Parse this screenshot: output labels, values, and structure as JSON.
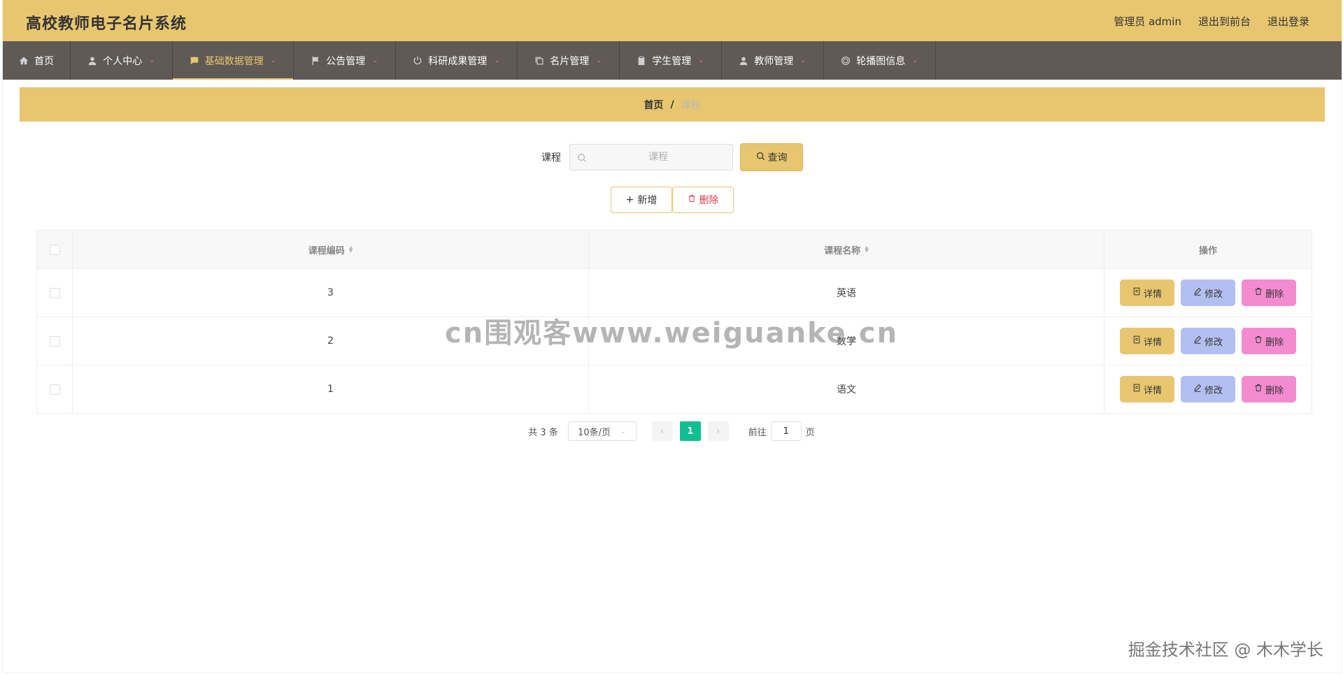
{
  "app": {
    "title": "高校教师电子名片系统"
  },
  "header_actions": {
    "admin": "管理员 admin",
    "front": "退出到前台",
    "logout": "退出登录"
  },
  "nav": [
    {
      "label": "首页",
      "icon": "home-icon",
      "dropdown": false,
      "active": false
    },
    {
      "label": "个人中心",
      "icon": "user-icon",
      "dropdown": true,
      "active": false
    },
    {
      "label": "基础数据管理",
      "icon": "message-icon",
      "dropdown": true,
      "active": true
    },
    {
      "label": "公告管理",
      "icon": "flag-icon",
      "dropdown": true,
      "active": false
    },
    {
      "label": "科研成果管理",
      "icon": "power-icon",
      "dropdown": true,
      "active": false
    },
    {
      "label": "名片管理",
      "icon": "copy-icon",
      "dropdown": true,
      "active": false
    },
    {
      "label": "学生管理",
      "icon": "clipboard-icon",
      "dropdown": true,
      "active": false
    },
    {
      "label": "教师管理",
      "icon": "user-icon",
      "dropdown": true,
      "active": false
    },
    {
      "label": "轮播图信息",
      "icon": "target-icon",
      "dropdown": true,
      "active": false
    }
  ],
  "breadcrumb": {
    "home": "首页",
    "separator": "/",
    "current": "课程"
  },
  "search": {
    "label": "课程",
    "placeholder": "课程",
    "value": "",
    "button": "查询"
  },
  "actions": {
    "add": "新增",
    "delete": "删除"
  },
  "table": {
    "headers": {
      "code": "课程编码",
      "name": "课程名称",
      "ops": "操作"
    },
    "rows": [
      {
        "code": "3",
        "name": "英语"
      },
      {
        "code": "2",
        "name": "数学"
      },
      {
        "code": "1",
        "name": "语文"
      }
    ],
    "row_buttons": {
      "detail": "详情",
      "edit": "修改",
      "delete": "删除"
    }
  },
  "pagination": {
    "total": "共 3 条",
    "page_size": "10条/页",
    "current_page": "1",
    "goto_label": "前往",
    "goto_value": "1",
    "goto_suffix": "页"
  },
  "watermarks": {
    "center": "cn围观客www.weiguanke.cn",
    "corner": "掘金技术社区 @ 木木学长"
  },
  "colors": {
    "accent": "#E8C670",
    "nav_bg": "#5f5a56",
    "edit_btn": "#b3bff0",
    "delete_btn": "#f48ad0",
    "page_active": "#0fbf8f"
  }
}
